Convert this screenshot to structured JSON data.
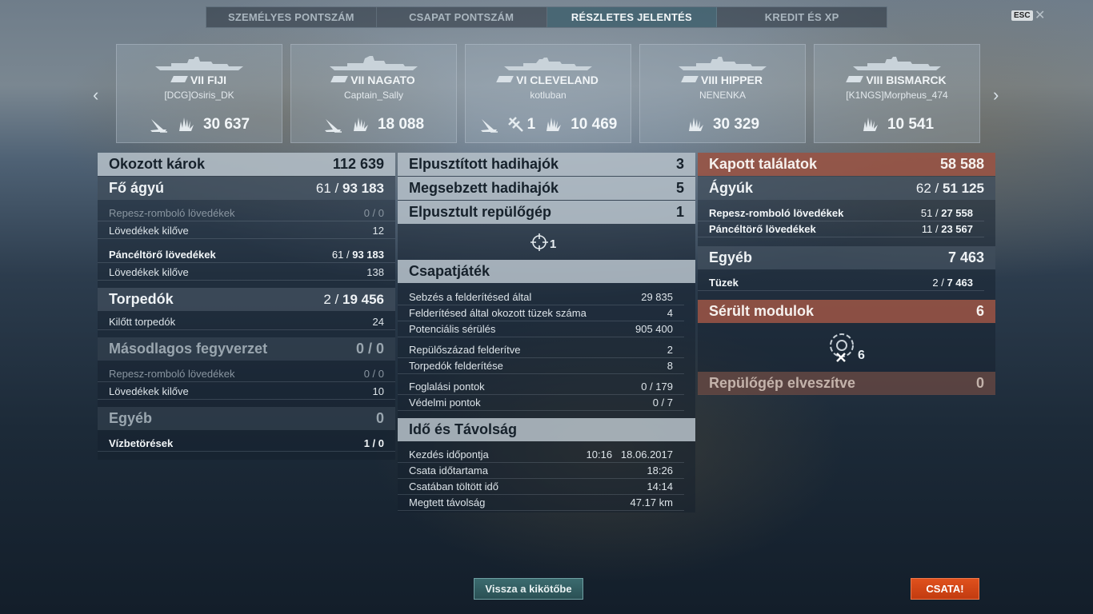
{
  "tabs": [
    "SZEMÉLYES PONTSZÁM",
    "CSAPAT PONTSZÁM",
    "RÉSZLETES JELENTÉS",
    "KREDIT ÉS XP"
  ],
  "active_tab": "RÉSZLETES JELENTÉS",
  "esc_label": "ESC",
  "close_glyph": "✕",
  "arrows": {
    "left": "‹",
    "right": "›"
  },
  "ships": [
    {
      "tier_name": "VII FIJI",
      "player": "[DCG]Osiris_DK",
      "damage": "30 637",
      "icons": [
        "torpedo-hit-icon"
      ]
    },
    {
      "tier_name": "VII NAGATO",
      "player": "Captain_Sally",
      "damage": "18 088",
      "icons": [
        "torpedo-hit-icon"
      ]
    },
    {
      "tier_name": "VI CLEVELAND",
      "player": "kotluban",
      "damage": "10 469",
      "planes": "1",
      "icons": [
        "torpedo-hit-icon",
        "plane-shot-icon"
      ]
    },
    {
      "tier_name": "VIII HIPPER",
      "player": "NENENKA",
      "damage": "30 329",
      "icons": []
    },
    {
      "tier_name": "VIII BISMARCK",
      "player": "[K1NGS]Morpheus_474",
      "damage": "10 541",
      "icons": []
    }
  ],
  "left": {
    "damage_dealt": {
      "label": "Okozott károk",
      "value": "112 639"
    },
    "main_guns": {
      "label": "Fő ágyú",
      "value_a": "61",
      "value_b": "93 183"
    },
    "he_shells": {
      "label": "Repesz-romboló lövedékek",
      "value": "0 / 0"
    },
    "he_fired": {
      "label": "Lövedékek kilőve",
      "value": "12"
    },
    "ap_shells": {
      "label": "Páncéltörő lövedékek",
      "value_a": "61",
      "value_b": "93 183"
    },
    "ap_fired": {
      "label": "Lövedékek kilőve",
      "value": "138"
    },
    "torpedoes": {
      "label": "Torpedók",
      "value_a": "2",
      "value_b": "19 456"
    },
    "torps_fired": {
      "label": "Kilőtt torpedók",
      "value": "24"
    },
    "secondary": {
      "label": "Másodlagos fegyverzet",
      "value": "0 / 0"
    },
    "sec_he": {
      "label": "Repesz-romboló lövedékek",
      "value": "0 / 0"
    },
    "sec_fired": {
      "label": "Lövedékek kilőve",
      "value": "10"
    },
    "other": {
      "label": "Egyéb",
      "value": "0"
    },
    "flooding": {
      "label": "Vízbetörések",
      "value": "1 / 0"
    }
  },
  "middle": {
    "destroyed": {
      "label": "Elpusztított hadihajók",
      "value": "3"
    },
    "damaged": {
      "label": "Megsebzett hadihajók",
      "value": "5"
    },
    "planes": {
      "label": "Elpusztult repülőgép",
      "value": "1"
    },
    "planes_icon_count": "1",
    "teamplay": {
      "title": "Csapatjáték",
      "rows": [
        {
          "label": "Sebzés a felderítésed által",
          "value": "29 835"
        },
        {
          "label": "Felderítésed által okozott tüzek száma",
          "value": "4"
        },
        {
          "label": "Potenciális sérülés",
          "value": "905 400"
        },
        {
          "label": "Repülőszázad felderítve",
          "value": "2"
        },
        {
          "label": "Torpedók felderítése",
          "value": "8"
        },
        {
          "label": "Foglalási pontok",
          "value": "0 / 179"
        },
        {
          "label": "Védelmi pontok",
          "value": "0 / 7"
        }
      ]
    },
    "time": {
      "title": "Idő és Távolság",
      "rows": [
        {
          "label": "Kezdés időpontja",
          "value": "10:16   18.06.2017"
        },
        {
          "label": "Csata időtartama",
          "value": "18:26"
        },
        {
          "label": "Csatában töltött idő",
          "value": "14:14"
        },
        {
          "label": "Megtett távolság",
          "value": "47.17 km"
        }
      ]
    }
  },
  "right": {
    "hits": {
      "label": "Kapott találatok",
      "value": "58 588"
    },
    "guns": {
      "label": "Ágyúk",
      "value_a": "62",
      "value_b": "51 125"
    },
    "he": {
      "label": "Repesz-romboló lövedékek",
      "value_a": "51",
      "value_b": "27 558"
    },
    "ap": {
      "label": "Páncéltörő lövedékek",
      "value_a": "11",
      "value_b": "23 567"
    },
    "other": {
      "label": "Egyéb",
      "value": "7 463"
    },
    "fires": {
      "label": "Tüzek",
      "value_a": "2",
      "value_b": "7 463"
    },
    "modules": {
      "label": "Sérült modulok",
      "value": "6"
    },
    "modules_icon_count": "6",
    "planes_lost": {
      "label": "Repülőgép elveszítve",
      "value": "0"
    }
  },
  "buttons": {
    "port": "Vissza a kikötőbe",
    "battle": "CSATA!"
  }
}
